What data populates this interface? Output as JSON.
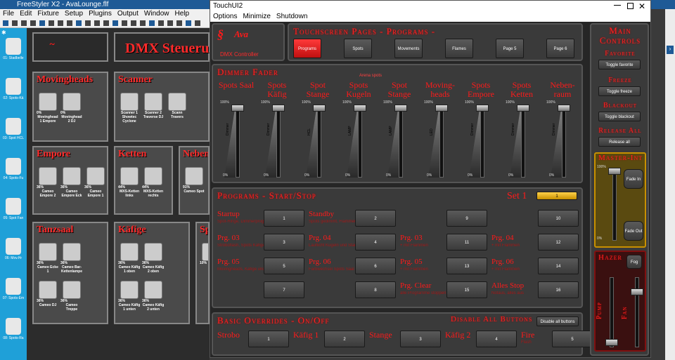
{
  "fs": {
    "title": "FreeStyler X2  -  AvaLounge.flf",
    "menu": [
      "File",
      "Edit",
      "Fixture",
      "Setup",
      "Plugins",
      "Output",
      "Window",
      "Help"
    ],
    "side": [
      "01: Stadbelle",
      "02: Spots-Kä",
      "03: Spot HCL",
      "04: Spots-Fu",
      "05: Spot Fan",
      "06: Mov.Hr",
      "07: Spots-Em",
      "08: Spots-Ra"
    ],
    "header_title": "DMX Steuerun",
    "groups": {
      "movingheads": {
        "title": "Movingheads",
        "fixtures": [
          {
            "pct": "0%",
            "name": "Movinghead 1 Empore"
          },
          {
            "pct": "0%",
            "name": "Movinghead 2 DJ"
          }
        ]
      },
      "scanner": {
        "title": "Scanner",
        "fixtures": [
          {
            "pct": "",
            "name": "Scanner 1 Showtec Cyclone"
          },
          {
            "pct": "",
            "name": "Scanner 2 Traverse DJ"
          },
          {
            "pct": "",
            "name": "Scann Travers"
          }
        ]
      },
      "empore": {
        "title": "Empore",
        "fixtures": [
          {
            "pct": "36%",
            "name": "Cameo Empore 2"
          },
          {
            "pct": "36%",
            "name": "Cameo Empore Eck"
          },
          {
            "pct": "36%",
            "name": "Cameo Empore 1"
          }
        ]
      },
      "ketten": {
        "title": "Ketten",
        "fixtures": [
          {
            "pct": "44%",
            "name": "MXS-Ketten links"
          },
          {
            "pct": "44%",
            "name": "MXS-Ketten rechts"
          }
        ]
      },
      "neben": {
        "title": "Neben",
        "fixtures": [
          {
            "pct": "91%",
            "name": "Cameo Spot"
          }
        ]
      },
      "tanzsaal": {
        "title": "Tanzsaal",
        "fixtures": [
          {
            "pct": "36%",
            "name": "Cameo Ecke 1"
          },
          {
            "pct": "36%",
            "name": "Cameo Bar-Kettenlampe"
          },
          {
            "pct": "36%",
            "name": "Cameo DJ"
          },
          {
            "pct": "36%",
            "name": "Cameo Treppe"
          }
        ]
      },
      "kaefige": {
        "title": "Käfige",
        "fixtures": [
          {
            "pct": "36%",
            "name": "Cameo Käfig 1 oben"
          },
          {
            "pct": "36%",
            "name": "Cameo Käfig 2 oben"
          },
          {
            "pct": "36%",
            "name": "Cameo Käfig 1 unten"
          },
          {
            "pct": "36%",
            "name": "Cameo Käfig 2 unten"
          }
        ]
      },
      "sp": {
        "title": "Sp",
        "fixtures": [
          {
            "pct": "10%",
            "name": "Tr"
          }
        ]
      }
    }
  },
  "tui": {
    "title": "TouchUI2",
    "menu": [
      "Options",
      "Minimize",
      "Shutdown"
    ],
    "logo_sub": "DMX Controller",
    "pages_title": "Touchscreen Pages - Programs -",
    "pages": [
      "Programs",
      "Spots",
      "Movements",
      "Flames",
      "Page 5",
      "Page 6"
    ],
    "dimmer_title": "Dimmer Fader",
    "dimmer_bracket": "Arena spots",
    "faders": [
      {
        "label": "Spots Saal",
        "vname": "Dimmer"
      },
      {
        "label": "Spots Käfig",
        "vname": "Dimmer"
      },
      {
        "label": "Spot Stange",
        "vname": "HCL"
      },
      {
        "label": "Spots Kugeln",
        "vname": "LAMP"
      },
      {
        "label": "Spot Stange",
        "vname": "LAMP"
      },
      {
        "label": "Moving-heads",
        "vname": "LED"
      },
      {
        "label": "Spots Empore",
        "vname": "Dimmer"
      },
      {
        "label": "Spots Ketten",
        "vname": "Dimmer"
      },
      {
        "label": "Neben-raum",
        "vname": "Dimmer"
      }
    ],
    "fader_top": "100%",
    "fader_bottom": "0%",
    "programs_title": "Programs - Start/Stop",
    "set_label": "Set 1",
    "set_value": "1",
    "programs": [
      {
        "title": "Startup",
        "sub": "Spot-Ringe, Dimmerprogramm",
        "num": "1"
      },
      {
        "title": "Standby",
        "sub": "Spots gedimmt, Flammen aus",
        "num": "2"
      },
      {
        "title": "",
        "sub": "",
        "num": "9"
      },
      {
        "title": "",
        "sub": "",
        "num": "10"
      },
      {
        "title": "Prg. 03",
        "sub": "Stroboflash, Spots Käfige",
        "num": "3"
      },
      {
        "title": "Prg. 04",
        "sub": "Lauflicht Kugeln und Stangen",
        "num": "4"
      },
      {
        "title": "Prg. 03",
        "sub": "+ mit Flammen",
        "num": "11"
      },
      {
        "title": "Prg. 04",
        "sub": "+ mit Flammen",
        "num": "12"
      },
      {
        "title": "Prg. 05",
        "sub": "Movingheads, Käfige und Raum",
        "num": "5"
      },
      {
        "title": "Prg. 06",
        "sub": "Farbwechsel Spots Saal und Ketten",
        "num": "6"
      },
      {
        "title": "Prg. 05",
        "sub": "+ mit Flammen",
        "num": "13"
      },
      {
        "title": "Prg. 06",
        "sub": "+ mit Flammen",
        "num": "14"
      },
      {
        "title": "",
        "sub": "",
        "num": "7"
      },
      {
        "title": "",
        "sub": "",
        "num": "8"
      },
      {
        "title": "Prg. Clear",
        "sub": "alle Programme stoppen",
        "num": "15"
      },
      {
        "title": "Alles Stop",
        "sub": "Notaus, alles aus",
        "num": "16"
      }
    ],
    "overrides_title": "Basic Overrides - On/Off",
    "disable_label": "Disable All Buttons",
    "disable_btn": "Disable all buttons",
    "overrides": [
      {
        "title": "Strobo",
        "sub": "",
        "num": "1"
      },
      {
        "title": "Käfig 1",
        "sub": "",
        "num": "2"
      },
      {
        "title": "Stange",
        "sub": "",
        "num": "3"
      },
      {
        "title": "Käfig 2",
        "sub": "",
        "num": "4"
      },
      {
        "title": "Fire",
        "sub": "Flash",
        "num": "5"
      }
    ],
    "main_title": "Main Controls",
    "favorite_label": "Favorite",
    "favorite_btn": "Toggle favorite",
    "freeze_label": "Freeze",
    "freeze_btn": "Toggle freeze",
    "blackout_label": "Blackout",
    "blackout_btn": "Toggle blackout",
    "release_label": "Release All",
    "release_btn": "Release all",
    "master_label": "Master-Int",
    "master_top": "100%",
    "master_bottom": "0%",
    "fade_in": "Fade In",
    "fade_out": "Fade Out",
    "hazer_label": "Hazer",
    "fog_btn": "Fog",
    "pump_label": "Pump",
    "fan_label": "Fan"
  }
}
